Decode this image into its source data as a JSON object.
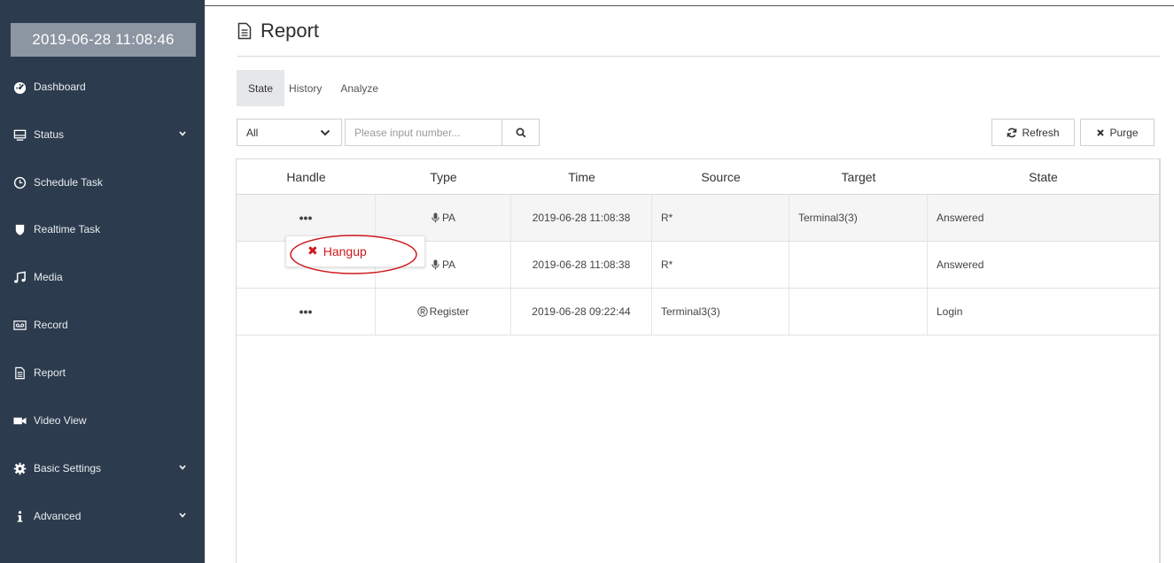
{
  "sidebar": {
    "datetime": "2019-06-28 11:08:46",
    "items": [
      {
        "label": "Dashboard",
        "icon": "dashboard-icon",
        "has_submenu": false
      },
      {
        "label": "Status",
        "icon": "monitor-icon",
        "has_submenu": true
      },
      {
        "label": "Schedule Task",
        "icon": "clock-icon",
        "has_submenu": false
      },
      {
        "label": "Realtime Task",
        "icon": "shield-icon",
        "has_submenu": false
      },
      {
        "label": "Media",
        "icon": "music-icon",
        "has_submenu": false
      },
      {
        "label": "Record",
        "icon": "tape-icon",
        "has_submenu": false
      },
      {
        "label": "Report",
        "icon": "file-text-icon",
        "has_submenu": false
      },
      {
        "label": "Video View",
        "icon": "video-camera-icon",
        "has_submenu": false
      },
      {
        "label": "Basic Settings",
        "icon": "gear-icon",
        "has_submenu": true
      },
      {
        "label": "Advanced",
        "icon": "info-icon",
        "has_submenu": true
      }
    ]
  },
  "page": {
    "title": "Report",
    "icon": "file-text-icon"
  },
  "tabs": [
    {
      "label": "State",
      "active": true
    },
    {
      "label": "History",
      "active": false
    },
    {
      "label": "Analyze",
      "active": false
    }
  ],
  "toolbar": {
    "filter_value": "All",
    "search_placeholder": "Please input number...",
    "refresh_label": "Refresh",
    "purge_label": "Purge"
  },
  "table": {
    "columns": [
      "Handle",
      "Type",
      "Time",
      "Source",
      "Target",
      "State"
    ],
    "rows": [
      {
        "handle": "•••",
        "type_icon": "microphone-icon",
        "type": "PA",
        "time": "2019-06-28 11:08:38",
        "source": "R*",
        "target": "Terminal3(3)",
        "state": "Answered"
      },
      {
        "handle": "•••",
        "type_icon": "microphone-icon",
        "type": "PA",
        "time": "2019-06-28 11:08:38",
        "source": "R*",
        "target": "",
        "state": "Answered"
      },
      {
        "handle": "•••",
        "type_icon": "registered-icon",
        "type": "Register",
        "time": "2019-06-28 09:22:44",
        "source": "Terminal3(3)",
        "target": "",
        "state": "Login"
      }
    ]
  },
  "popup": {
    "hangup_label": "Hangup"
  },
  "colors": {
    "sidebar_bg": "#2c3b4d",
    "datetime_bg": "#8c96a3",
    "hangup_red": "#d0191c"
  }
}
